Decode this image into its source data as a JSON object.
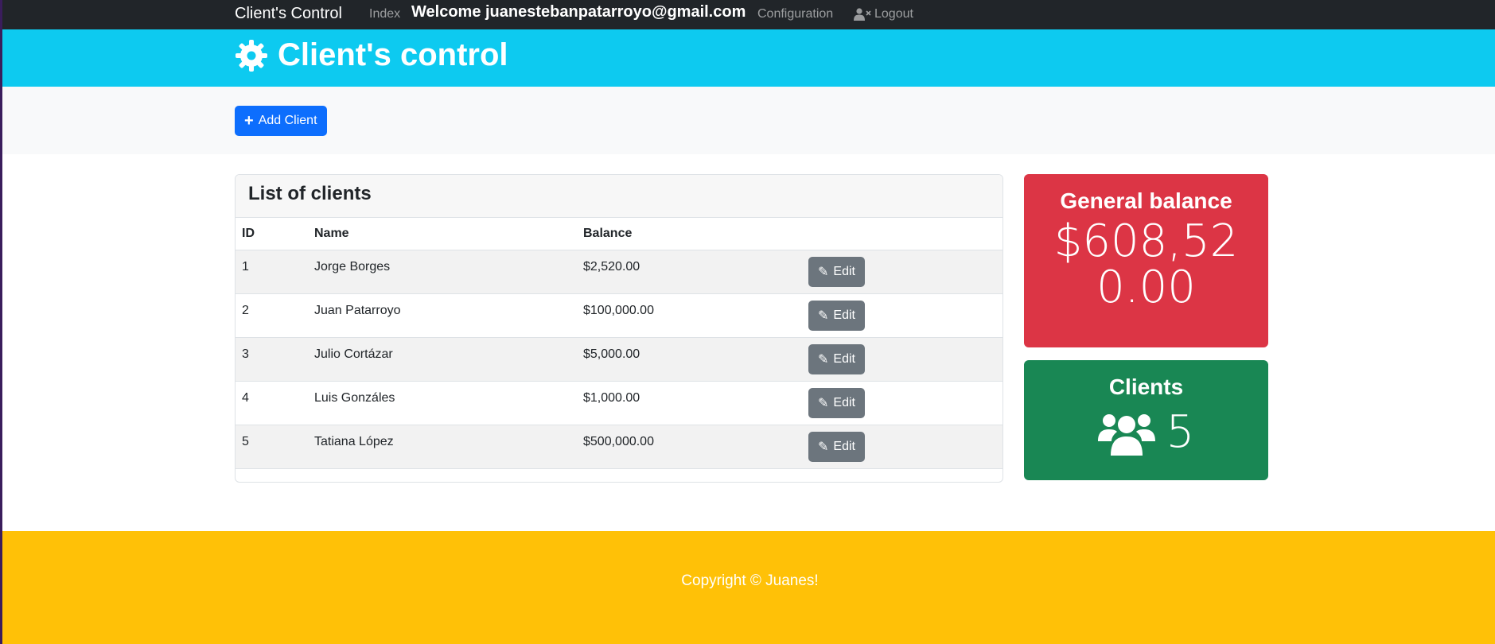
{
  "navbar": {
    "brand": "Client's Control",
    "index_link": "Index",
    "welcome": "Welcome juanestebanpatarroyo@gmail.com",
    "configuration_link": "Configuration",
    "logout_link": "Logout"
  },
  "header": {
    "title": "Client's control",
    "icon": "gear-icon"
  },
  "actions": {
    "add_client": "Add Client"
  },
  "clients_card": {
    "title": "List of clients",
    "columns": [
      "ID",
      "Name",
      "Balance"
    ],
    "rows": [
      {
        "id": "1",
        "name": "Jorge Borges",
        "balance": "$2,520.00",
        "edit": "Edit"
      },
      {
        "id": "2",
        "name": "Juan Patarroyo",
        "balance": "$100,000.00",
        "edit": "Edit"
      },
      {
        "id": "3",
        "name": "Julio Cortázar",
        "balance": "$5,000.00",
        "edit": "Edit"
      },
      {
        "id": "4",
        "name": "Luis Gonzáles",
        "balance": "$1,000.00",
        "edit": "Edit"
      },
      {
        "id": "5",
        "name": "Tatiana López",
        "balance": "$500,000.00",
        "edit": "Edit"
      }
    ]
  },
  "balance_card": {
    "label": "General balance",
    "value": "$608,520.00"
  },
  "clients_count_card": {
    "label": "Clients",
    "value": "5",
    "icon": "users-icon"
  },
  "footer": {
    "copyright": "Copyright © Juanes!"
  },
  "colors": {
    "navbar": "#212529",
    "header": "#0dcaf0",
    "primary": "#0d6efd",
    "secondary": "#6c757d",
    "danger": "#dc3545",
    "success": "#198754",
    "warning": "#ffc107"
  }
}
